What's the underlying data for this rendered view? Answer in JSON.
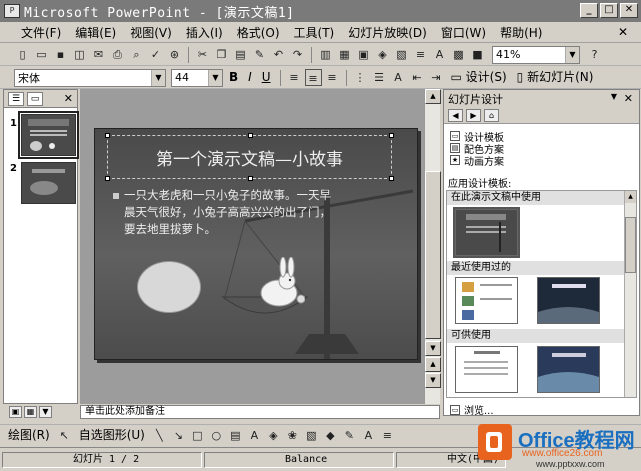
{
  "window": {
    "app_icon": "P",
    "title": "Microsoft PowerPoint - [演示文稿1]",
    "buttons": [
      "_",
      "□",
      "✕"
    ]
  },
  "menubar": {
    "items": [
      "文件(F)",
      "编辑(E)",
      "视图(V)",
      "插入(I)",
      "格式(O)",
      "工具(T)",
      "幻灯片放映(D)",
      "窗口(W)",
      "帮助(H)"
    ],
    "close": "✕"
  },
  "standard_toolbar": {
    "zoom": "41%"
  },
  "formatting_toolbar": {
    "font": "宋体",
    "size": "44",
    "bold": "B",
    "italic": "I",
    "underline": "U",
    "design_button": "设计(S)",
    "new_slide_button": "新幻灯片(N)"
  },
  "left_pane": {
    "close": "✕",
    "slides": [
      "1",
      "2"
    ]
  },
  "slide": {
    "title": "第一个演示文稿—小故事",
    "body_lines": [
      "一只大老虎和一只小兔子的故事。一天早",
      "晨天气很好，小兔子高高兴兴的出了门，",
      "要去地里拔萝卜。"
    ]
  },
  "notes": {
    "placeholder": "单击此处添加备注"
  },
  "task_pane": {
    "title": "幻灯片设计",
    "links": [
      "设计模板",
      "配色方案",
      "动画方案"
    ],
    "apply_label": "应用设计模板:",
    "sections": [
      "在此演示文稿中使用",
      "最近使用过的",
      "可供使用"
    ],
    "browse": "浏览..."
  },
  "drawing_toolbar": {
    "draw_label": "绘图(R)",
    "autoshapes_label": "自选图形(U)"
  },
  "status_bar": {
    "slide_info": "幻灯片 1 / 2",
    "design": "Balance",
    "language": "中文(中国)"
  },
  "watermark": {
    "brand": "Office教程网",
    "url": "www.office26.com",
    "url2": "www.pptxxw.com"
  }
}
